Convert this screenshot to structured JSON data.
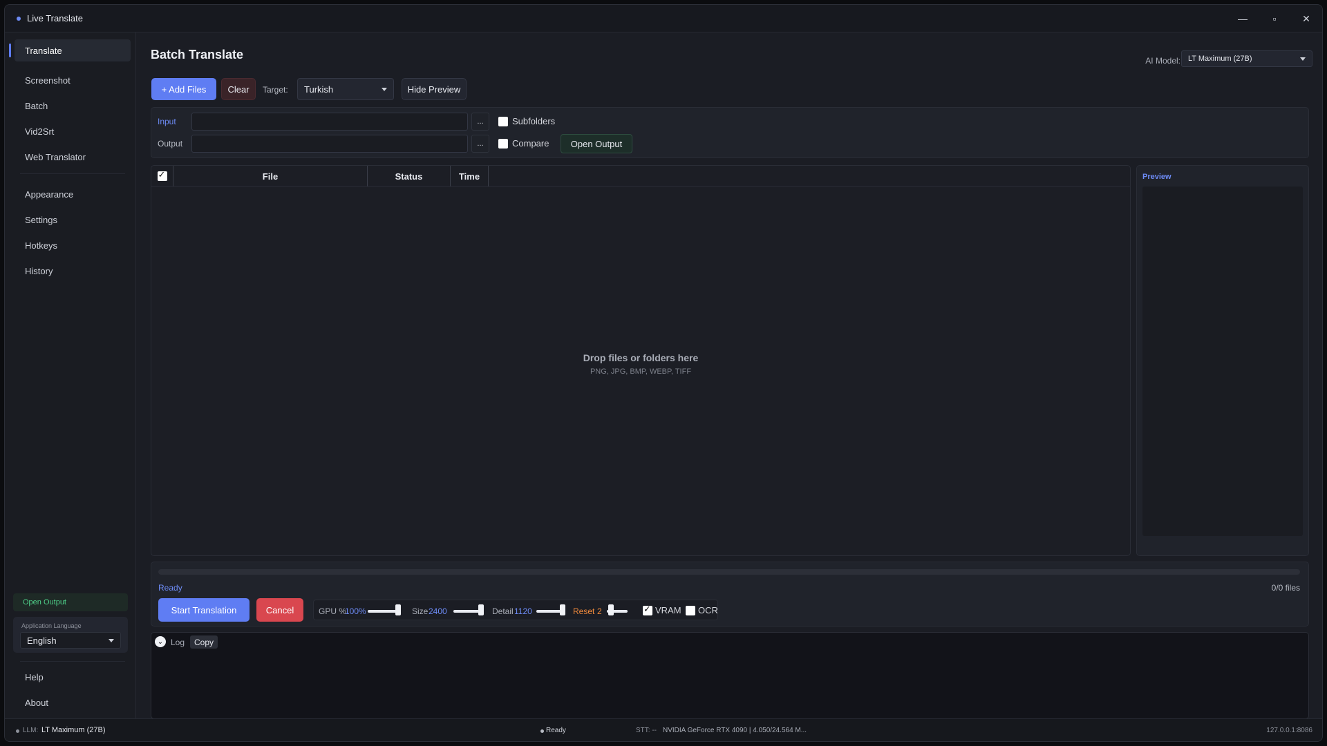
{
  "app": {
    "title": "Live Translate"
  },
  "window_controls": {
    "minimize": "—",
    "maximize": "▫",
    "close": "✕"
  },
  "sidebar": {
    "items": [
      {
        "label": "Translate",
        "active": true
      },
      {
        "label": "Screenshot"
      },
      {
        "label": "Batch"
      },
      {
        "label": "Vid2Srt"
      },
      {
        "label": "Web Translator"
      },
      {
        "label": "Appearance"
      },
      {
        "label": "Settings"
      },
      {
        "label": "Hotkeys"
      },
      {
        "label": "History"
      }
    ],
    "open_output": "Open Output",
    "language_label": "Application Language",
    "language_value": "English",
    "help": "Help",
    "about": "About"
  },
  "main": {
    "title": "Batch Translate",
    "ai_model_label": "AI Model:",
    "ai_model_value": "LT Maximum (27B)",
    "toolbar": {
      "add_files": "+ Add Files",
      "clear": "Clear",
      "target_label": "Target:",
      "target_value": "Turkish",
      "hide_preview": "Hide Preview"
    },
    "io": {
      "input_label": "Input",
      "output_label": "Output",
      "input_value": "",
      "output_value": "",
      "browse": "...",
      "subfolders": "Subfolders",
      "compare": "Compare",
      "open_output": "Open Output"
    },
    "files": {
      "columns": [
        "File",
        "Status",
        "Time"
      ],
      "drop_title": "Drop files or folders here",
      "drop_formats": "PNG, JPG, BMP, WEBP, TIFF"
    },
    "preview": {
      "title": "Preview"
    },
    "controls": {
      "status": "Ready",
      "count": "0/0 files",
      "start": "Start Translation",
      "cancel": "Cancel",
      "gpu_label": "GPU %",
      "gpu_value": "100%",
      "size_label": "Size",
      "size_value": "2400",
      "detail_label": "Detail",
      "detail_value": "1120",
      "reset_label": "Reset",
      "reset_value": "2",
      "vram": "VRAM",
      "ocr": "OCR",
      "vram_checked": true,
      "ocr_checked": false,
      "progress": 0
    },
    "log": {
      "label": "Log",
      "copy": "Copy"
    }
  },
  "statusbar": {
    "llm_label": "LLM:",
    "llm_value": "LT Maximum (27B)",
    "status": "Ready",
    "stt": "STT: --",
    "gpu": "NVIDIA GeForce RTX 4090 | 4.050/24.564 M...",
    "address": "127.0.0.1:8086"
  },
  "colors": {
    "accent": "#5f7df3",
    "danger": "#d9474f",
    "success": "#4fd18a",
    "warning": "#f08a3c"
  }
}
